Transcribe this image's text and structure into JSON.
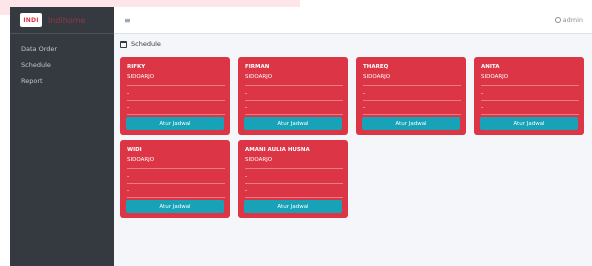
{
  "brand": {
    "logo_text": "INDI",
    "name": "Indihome"
  },
  "sidebar": {
    "items": [
      {
        "label": "Data Order"
      },
      {
        "label": "Schedule"
      },
      {
        "label": "Report"
      }
    ]
  },
  "topbar": {
    "menu_icon": "≡",
    "user_label": "admin"
  },
  "page": {
    "title": "Schedule"
  },
  "cards": [
    {
      "name": "RIFKY",
      "city": "SIDOARJO",
      "line1": "-",
      "line2": "-",
      "button": "Atur Jadwal"
    },
    {
      "name": "FIRMAN",
      "city": "SIDOARJO",
      "line1": "-",
      "line2": "-",
      "button": "Atur Jadwal"
    },
    {
      "name": "THAREQ",
      "city": "SIDOARJO",
      "line1": "-",
      "line2": "-",
      "button": "Atur Jadwal"
    },
    {
      "name": "ANITA",
      "city": "SIDOARJO",
      "line1": "-",
      "line2": "-",
      "button": "Atur Jadwal"
    },
    {
      "name": "WIDI",
      "city": "SIDOARJO",
      "line1": "-",
      "line2": "-",
      "button": "Atur Jadwal"
    },
    {
      "name": "AMANI AULIA HUSNA",
      "city": "SIDOARJO",
      "line1": "-",
      "line2": "-",
      "button": "Atur Jadwal"
    }
  ],
  "colors": {
    "sidebar_bg": "#343a40",
    "card_bg": "#dc3545",
    "button_bg": "#17a2b8",
    "content_bg": "#f4f6f9"
  },
  "icons": {
    "menu": "hamburger-menu-icon",
    "user": "user-icon",
    "page": "calendar-icon"
  }
}
